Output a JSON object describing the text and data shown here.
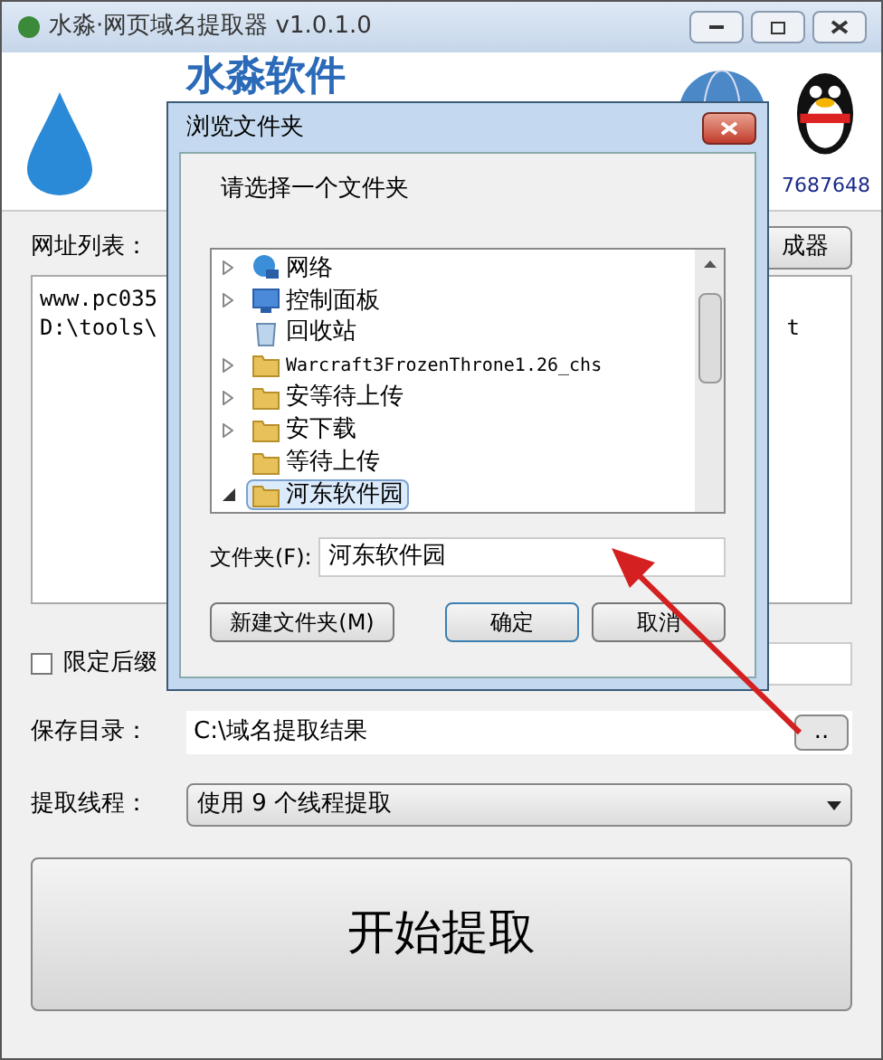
{
  "window": {
    "title": "水淼·网页域名提取器 v1.0.1.0"
  },
  "banner": {
    "logo_text": "水淼软件",
    "contact": "7687648"
  },
  "url_list": {
    "label": "网址列表：",
    "button": "成器",
    "lines": [
      {
        "left": "www.pc035"
      },
      {
        "left": "D:\\tools\\",
        "right": "t"
      }
    ]
  },
  "suffix_filter": {
    "label": "限定后缀",
    "checked": false
  },
  "save_dir": {
    "label": "保存目录：",
    "value": "C:\\域名提取结果",
    "browse": ".."
  },
  "threads": {
    "label": "提取线程：",
    "value": "使用 9 个线程提取"
  },
  "start_button": "开始提取",
  "dialog": {
    "title": "浏览文件夹",
    "prompt": "请选择一个文件夹",
    "tree": [
      {
        "label": "网络",
        "kind": "network",
        "expandable": true,
        "expanded": false,
        "selected": false
      },
      {
        "label": "控制面板",
        "kind": "panel",
        "expandable": true,
        "expanded": false,
        "selected": false
      },
      {
        "label": "回收站",
        "kind": "bin",
        "expandable": false,
        "selected": false
      },
      {
        "label": "Warcraft3FrozenThrone1.26_chs",
        "kind": "folder",
        "expandable": true,
        "expanded": false,
        "selected": false
      },
      {
        "label": "安等待上传",
        "kind": "folder",
        "expandable": true,
        "expanded": false,
        "selected": false
      },
      {
        "label": "安下载",
        "kind": "folder",
        "expandable": true,
        "expanded": false,
        "selected": false
      },
      {
        "label": "等待上传",
        "kind": "folder",
        "expandable": false,
        "selected": false
      },
      {
        "label": "河东软件园",
        "kind": "folder",
        "expandable": true,
        "expanded": true,
        "selected": true
      }
    ],
    "folder_label": "文件夹(F):",
    "folder_value": "河东软件园",
    "buttons": [
      {
        "label": "新建文件夹(M)",
        "default": false
      },
      {
        "label": "确定",
        "default": true
      },
      {
        "label": "取消",
        "default": false
      }
    ]
  }
}
